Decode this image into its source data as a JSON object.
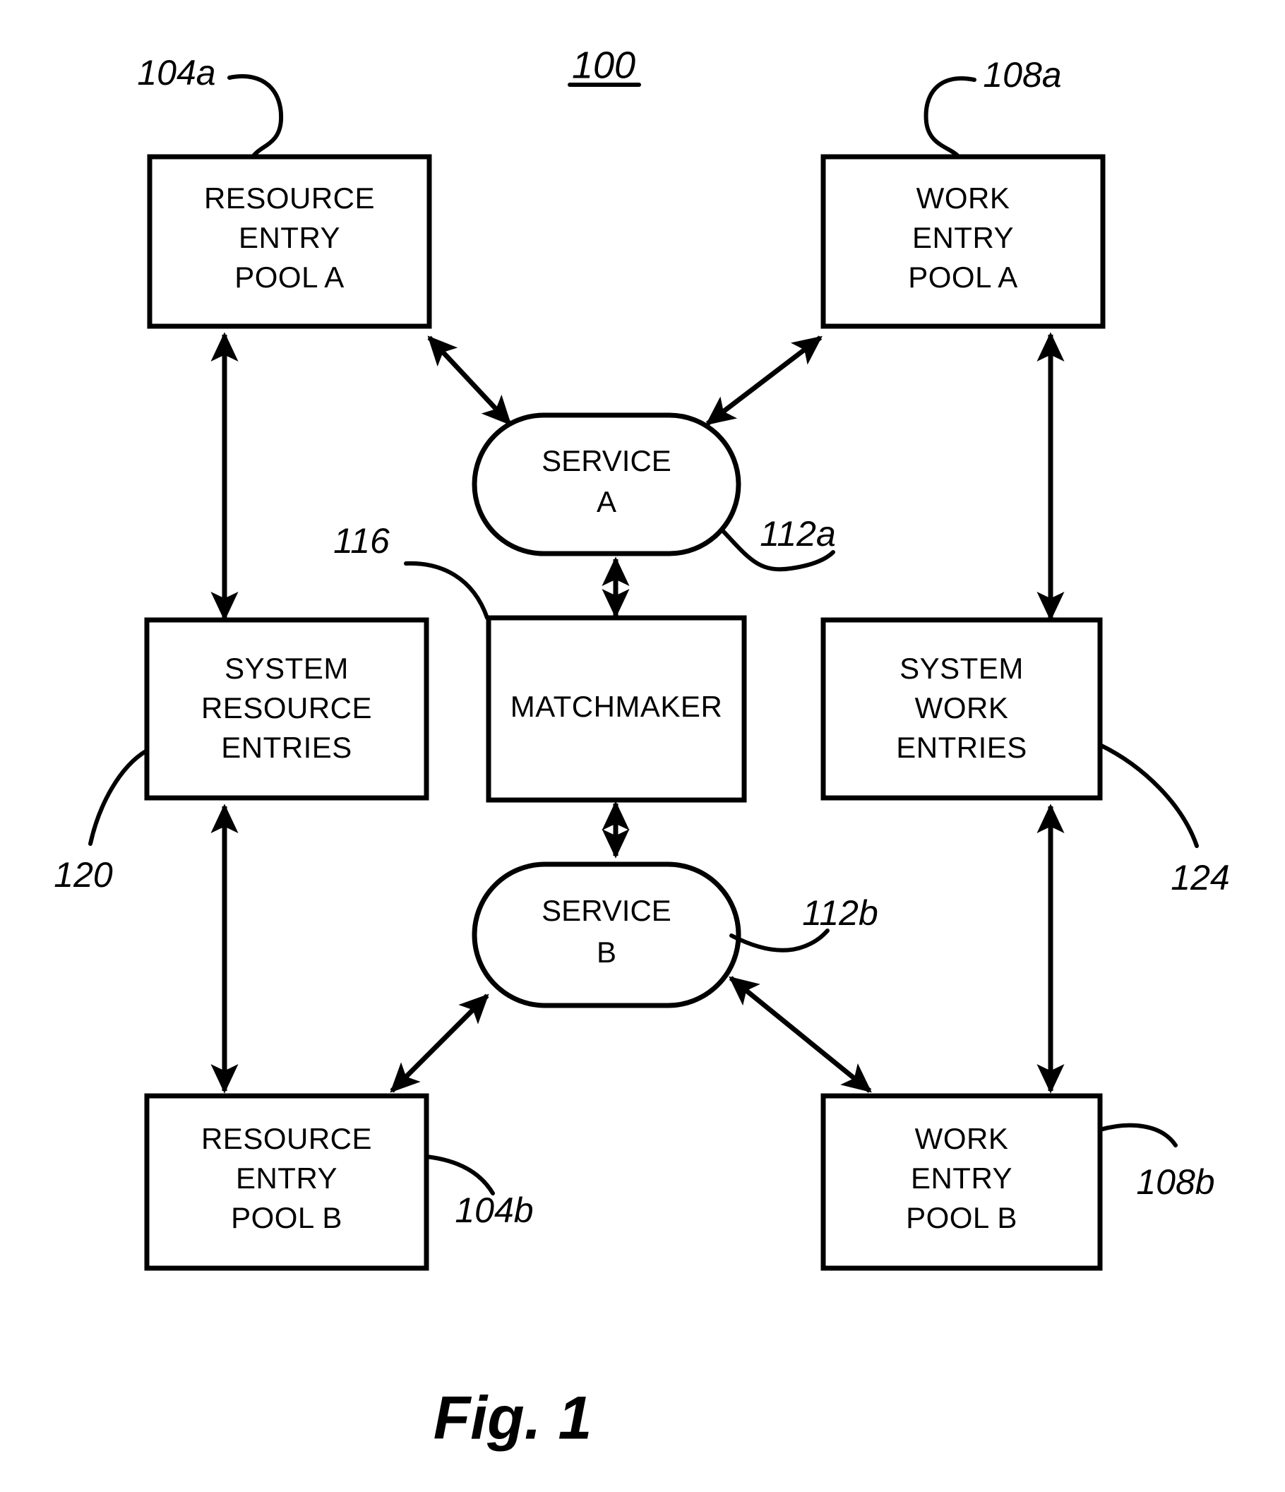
{
  "figure": {
    "number_label": "100",
    "caption": "Fig. 1"
  },
  "nodes": {
    "resource_entry_pool_a": {
      "lines": [
        "RESOURCE",
        "ENTRY",
        "POOL A"
      ],
      "ref": "104a",
      "shape": "rectangle"
    },
    "work_entry_pool_a": {
      "lines": [
        "WORK",
        "ENTRY",
        "POOL A"
      ],
      "ref": "108a",
      "shape": "rectangle"
    },
    "service_a": {
      "lines": [
        "SERVICE",
        "A"
      ],
      "ref": "112a",
      "shape": "stadium"
    },
    "system_resource_entries": {
      "lines": [
        "SYSTEM",
        "RESOURCE",
        "ENTRIES"
      ],
      "ref": "120",
      "shape": "rectangle"
    },
    "matchmaker": {
      "lines": [
        "MATCHMAKER"
      ],
      "ref": "116",
      "shape": "rectangle"
    },
    "system_work_entries": {
      "lines": [
        "SYSTEM",
        "WORK",
        "ENTRIES"
      ],
      "ref": "124",
      "shape": "rectangle"
    },
    "service_b": {
      "lines": [
        "SERVICE",
        "B"
      ],
      "ref": "112b",
      "shape": "stadium"
    },
    "resource_entry_pool_b": {
      "lines": [
        "RESOURCE",
        "ENTRY",
        "POOL B"
      ],
      "ref": "104b",
      "shape": "rectangle"
    },
    "work_entry_pool_b": {
      "lines": [
        "WORK",
        "ENTRY",
        "POOL B"
      ],
      "ref": "108b",
      "shape": "rectangle"
    }
  },
  "connections": [
    {
      "from": "resource_entry_pool_a",
      "to": "service_a",
      "arrow": "double"
    },
    {
      "from": "work_entry_pool_a",
      "to": "service_a",
      "arrow": "double"
    },
    {
      "from": "resource_entry_pool_a",
      "to": "system_resource_entries",
      "arrow": "double"
    },
    {
      "from": "work_entry_pool_a",
      "to": "system_work_entries",
      "arrow": "double"
    },
    {
      "from": "service_a",
      "to": "matchmaker",
      "arrow": "double"
    },
    {
      "from": "matchmaker",
      "to": "service_b",
      "arrow": "double"
    },
    {
      "from": "system_resource_entries",
      "to": "resource_entry_pool_b",
      "arrow": "double"
    },
    {
      "from": "system_work_entries",
      "to": "work_entry_pool_b",
      "arrow": "double"
    },
    {
      "from": "resource_entry_pool_b",
      "to": "service_b",
      "arrow": "double"
    },
    {
      "from": "work_entry_pool_b",
      "to": "service_b",
      "arrow": "double"
    }
  ],
  "colors": {
    "stroke": "#000000",
    "background": "#ffffff"
  }
}
